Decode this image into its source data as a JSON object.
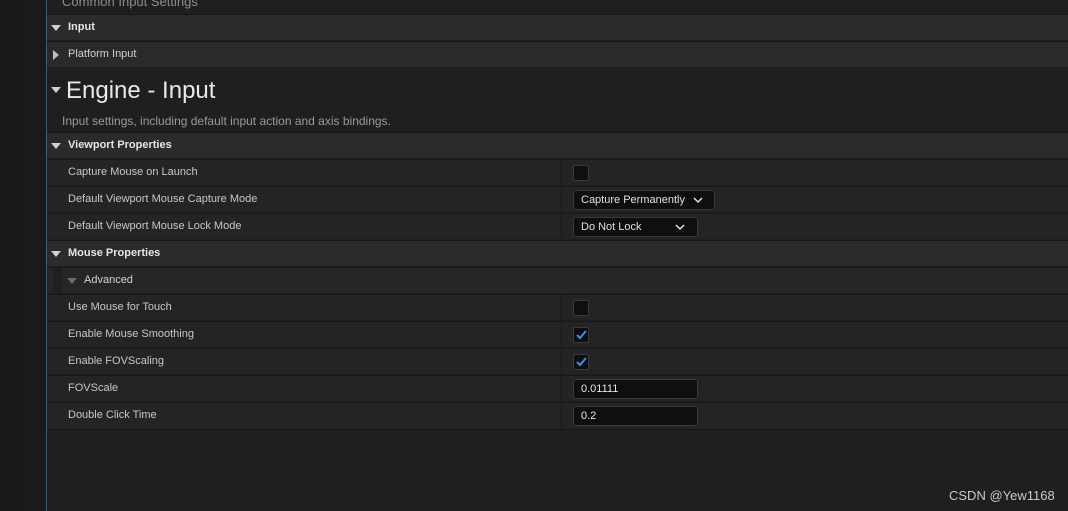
{
  "common_input_settings_title": "Common Input Settings",
  "sections": {
    "input": "Input",
    "platform_input": "Platform Input"
  },
  "engine_input": {
    "title": "Engine - Input",
    "description": "Input settings, including default input action and axis bindings."
  },
  "viewport_properties": {
    "header": "Viewport Properties",
    "capture_mouse_on_launch": {
      "label": "Capture Mouse on Launch",
      "checked": false
    },
    "capture_mode": {
      "label": "Default Viewport Mouse Capture Mode",
      "value": "Capture Permanently"
    },
    "lock_mode": {
      "label": "Default Viewport Mouse Lock Mode",
      "value": "Do Not Lock"
    }
  },
  "mouse_properties": {
    "header": "Mouse Properties",
    "advanced": "Advanced",
    "use_mouse_for_touch": {
      "label": "Use Mouse for Touch",
      "checked": false
    },
    "enable_mouse_smoothing": {
      "label": "Enable Mouse Smoothing",
      "checked": true
    },
    "enable_fov_scaling": {
      "label": "Enable FOVScaling",
      "checked": true
    },
    "fov_scale": {
      "label": "FOVScale",
      "value": "0.01111"
    },
    "double_click_time": {
      "label": "Double Click Time",
      "value": "0.2"
    }
  },
  "watermark": "CSDN @Yew1168",
  "colors": {
    "accent": "#2f5d8a",
    "check": "#3d8ee6",
    "background": "#1f1f1f"
  }
}
